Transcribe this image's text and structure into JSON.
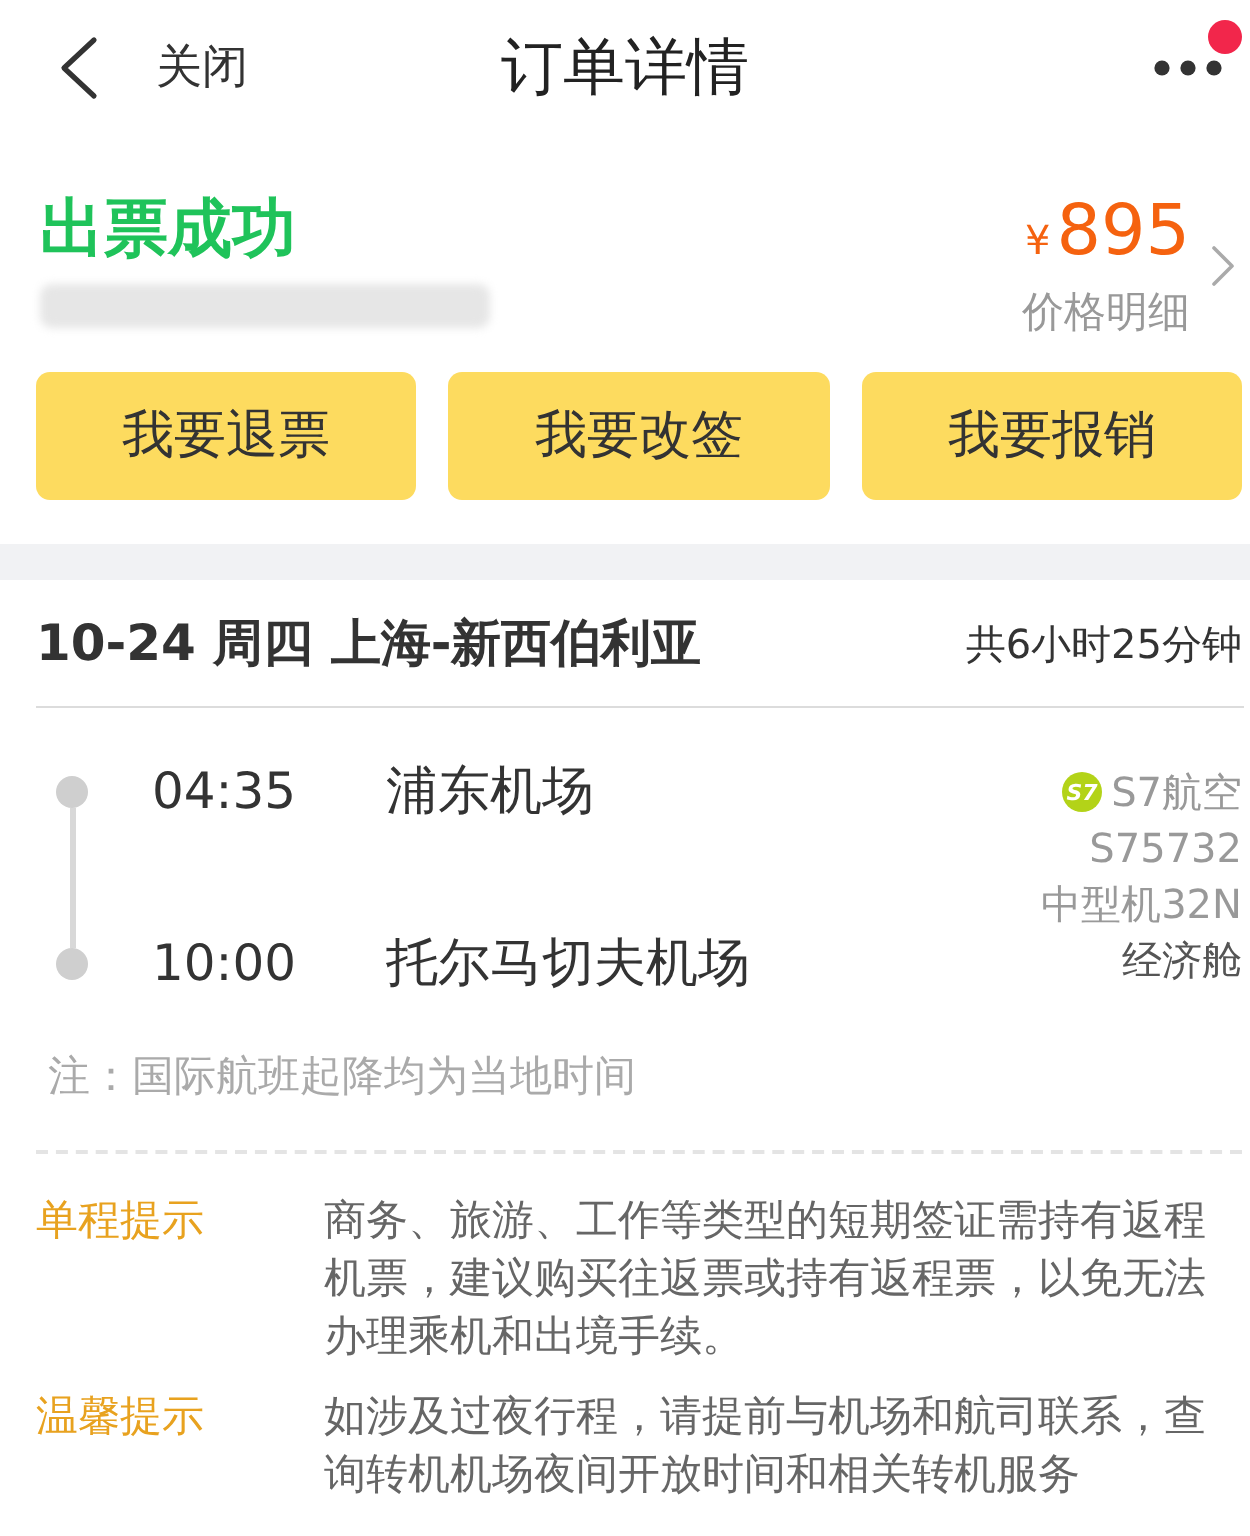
{
  "header": {
    "close_label": "关闭",
    "title": "订单详情",
    "notification_dot": true
  },
  "order": {
    "status": "出票成功",
    "currency": "¥",
    "price": "895",
    "price_detail_link": "价格明细"
  },
  "actions": [
    "我要退票",
    "我要改签",
    "我要报销"
  ],
  "flight": {
    "heading": "10-24 周四 上海-新西伯利亚",
    "duration": "共6小时25分钟",
    "segments": [
      {
        "time": "04:35",
        "airport": "浦东机场"
      },
      {
        "time": "10:00",
        "airport": "托尔马切夫机场"
      }
    ],
    "airline": {
      "logo_text": "S7",
      "name": "S7航空"
    },
    "flight_no": "S75732",
    "aircraft": "中型机32N",
    "cabin": "经济舱"
  },
  "note": "注：国际航班起降均为当地时间",
  "tips": [
    {
      "label": "单程提示",
      "text": "商务、旅游、工作等类型的短期签证需持有返程机票，建议购买往返票或持有返程票，以免无法办理乘机和出境手续。"
    },
    {
      "label": "温馨提示",
      "text": "如涉及过夜行程，请提前与机场和航司联系，查询转机机场夜间开放时间和相关转机服务"
    }
  ]
}
